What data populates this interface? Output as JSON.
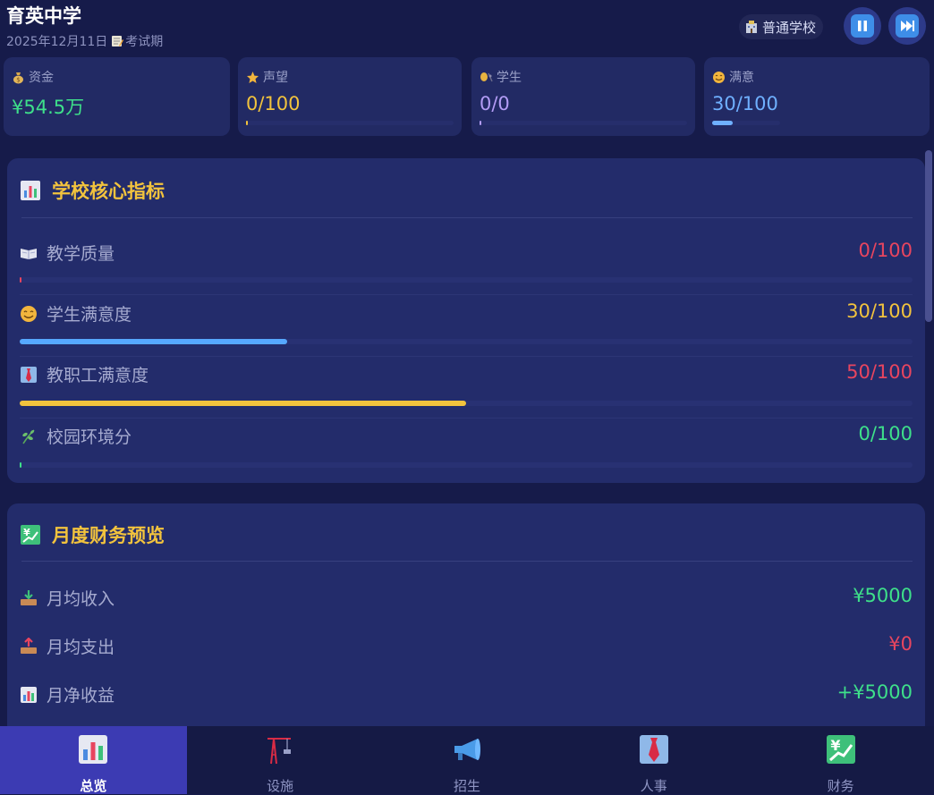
{
  "header": {
    "school_name": "育英中学",
    "date": "2025年12月11日",
    "period": "考试期",
    "school_type": "普通学校",
    "pause_label": "暂停",
    "fast_forward_label": "快进"
  },
  "stats": [
    {
      "key": "funds",
      "label": "资金",
      "value": "¥54.5万",
      "color": "#3ee08a",
      "progress": null
    },
    {
      "key": "reputation",
      "label": "声望",
      "value": "0/100",
      "color": "#f2c33d",
      "progress": 0
    },
    {
      "key": "students",
      "label": "学生",
      "value": "0/0",
      "color": "#b39cf5",
      "progress": 0
    },
    {
      "key": "satisfaction",
      "label": "满意",
      "value": "30/100",
      "color": "#6fb0ff",
      "progress": 30
    }
  ],
  "core_metrics": {
    "title": "学校核心指标",
    "items": [
      {
        "key": "teaching",
        "label": "教学质量",
        "value": "0/100",
        "value_color": "#e8455f",
        "bar_color": "#e8455f",
        "progress": 0
      },
      {
        "key": "student_satisfaction",
        "label": "学生满意度",
        "value": "30/100",
        "value_color": "#f2c33d",
        "bar_color": "#56a8ff",
        "progress": 30
      },
      {
        "key": "staff_satisfaction",
        "label": "教职工满意度",
        "value": "50/100",
        "value_color": "#e8455f",
        "bar_color": "#f2c33d",
        "progress": 50
      },
      {
        "key": "environment",
        "label": "校园环境分",
        "value": "0/100",
        "value_color": "#3ee08a",
        "bar_color": "#3ee08a",
        "progress": 0
      }
    ]
  },
  "finance": {
    "title": "月度财务预览",
    "items": [
      {
        "key": "income",
        "label": "月均收入",
        "value": "¥5000",
        "value_color": "#3ee08a"
      },
      {
        "key": "expense",
        "label": "月均支出",
        "value": "¥0",
        "value_color": "#e8455f"
      },
      {
        "key": "net",
        "label": "月净收益",
        "value": "+¥5000",
        "value_color": "#3ee08a"
      }
    ]
  },
  "nav": {
    "items": [
      {
        "key": "overview",
        "label": "总览",
        "active": true
      },
      {
        "key": "facilities",
        "label": "设施",
        "active": false
      },
      {
        "key": "enrollment",
        "label": "招生",
        "active": false
      },
      {
        "key": "hr",
        "label": "人事",
        "active": false
      },
      {
        "key": "finance",
        "label": "财务",
        "active": false
      }
    ]
  }
}
